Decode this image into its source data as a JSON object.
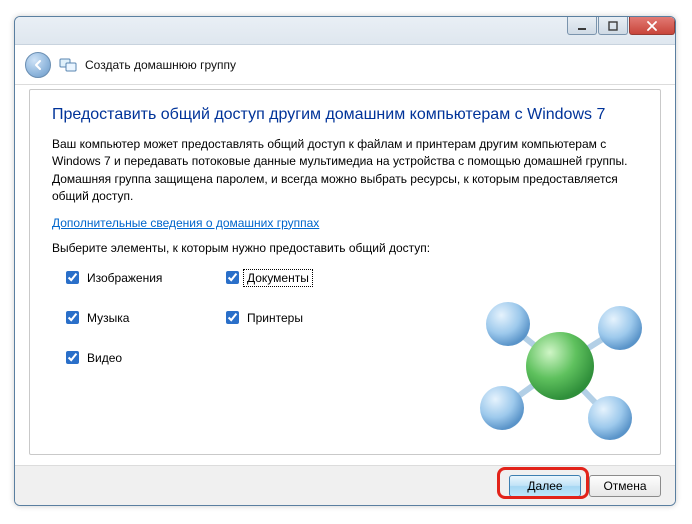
{
  "window": {
    "title": "Создать домашнюю группу"
  },
  "heading": "Предоставить общий доступ другим домашним компьютерам с Windows 7",
  "body_text": "Ваш компьютер может предоставлять общий доступ к файлам и принтерам другим компьютерам с Windows 7 и передавать потоковые данные мультимедиа на устройства с помощью домашней группы. Домашняя группа защищена паролем, и всегда можно выбрать ресурсы, к которым предоставляется общий доступ.",
  "link_text": "Дополнительные сведения о домашних группах",
  "prompt_text": "Выберите элементы, к которым нужно предоставить общий доступ:",
  "items": {
    "images": {
      "label": "Изображения",
      "checked": true
    },
    "documents": {
      "label": "Документы",
      "checked": true,
      "focused": true
    },
    "music": {
      "label": "Музыка",
      "checked": true
    },
    "printers": {
      "label": "Принтеры",
      "checked": true
    },
    "video": {
      "label": "Видео",
      "checked": true
    }
  },
  "buttons": {
    "next": "Далее",
    "cancel": "Отмена"
  }
}
